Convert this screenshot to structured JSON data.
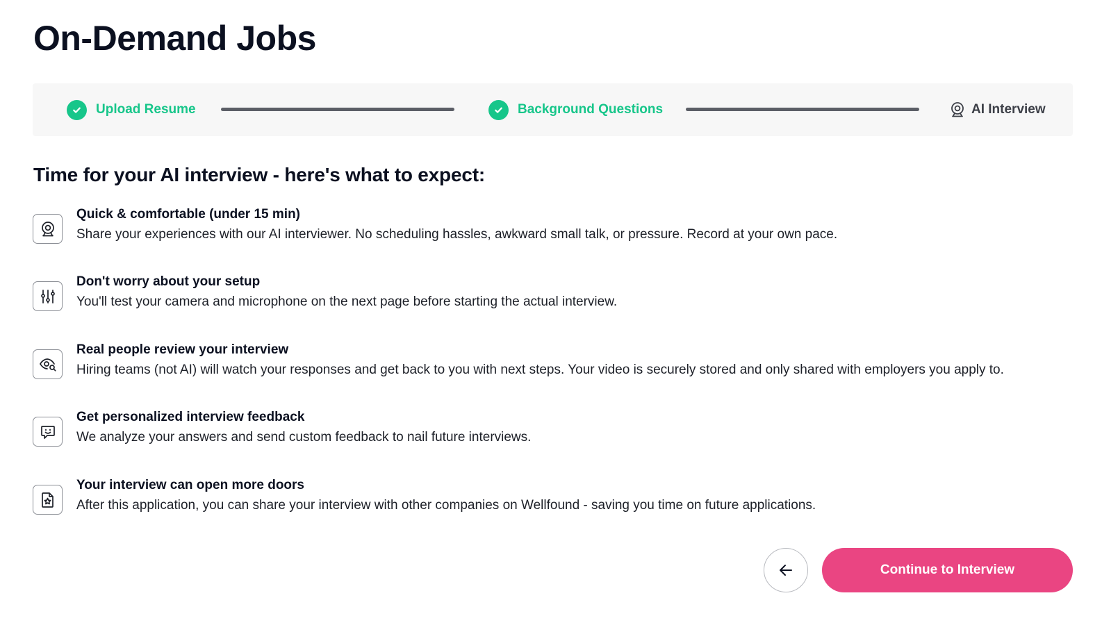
{
  "page": {
    "title": "On-Demand Jobs"
  },
  "stepper": {
    "steps": [
      {
        "label": "Upload Resume",
        "status": "complete"
      },
      {
        "label": "Background Questions",
        "status": "complete"
      },
      {
        "label": "AI Interview",
        "status": "current"
      }
    ],
    "colors": {
      "complete": "#17c68a",
      "line": "#5b5e66"
    }
  },
  "main": {
    "heading": "Time for your AI interview - here's what to expect:",
    "features": [
      {
        "icon": "webcam-icon",
        "title": "Quick & comfortable (under 15 min)",
        "description": "Share your experiences with our AI interviewer. No scheduling hassles, awkward small talk, or pressure. Record at your own pace."
      },
      {
        "icon": "sliders-icon",
        "title": "Don't worry about your setup",
        "description": "You'll test your camera and microphone on the next page before starting the actual interview."
      },
      {
        "icon": "eye-search-icon",
        "title": "Real people review your interview",
        "description": "Hiring teams (not AI) will watch your responses and get back to you with next steps. Your video is securely stored and only shared with employers you apply to."
      },
      {
        "icon": "chat-smile-icon",
        "title": "Get personalized interview feedback",
        "description": "We analyze your answers and send custom feedback to nail future interviews."
      },
      {
        "icon": "document-star-icon",
        "title": "Your interview can open more doors",
        "description": "After this application, you can share your interview with other companies on Wellfound - saving you time on future applications."
      }
    ]
  },
  "footer": {
    "back_icon": "arrow-left-icon",
    "continue_label": "Continue to Interview",
    "accent_color": "#ea4582"
  }
}
